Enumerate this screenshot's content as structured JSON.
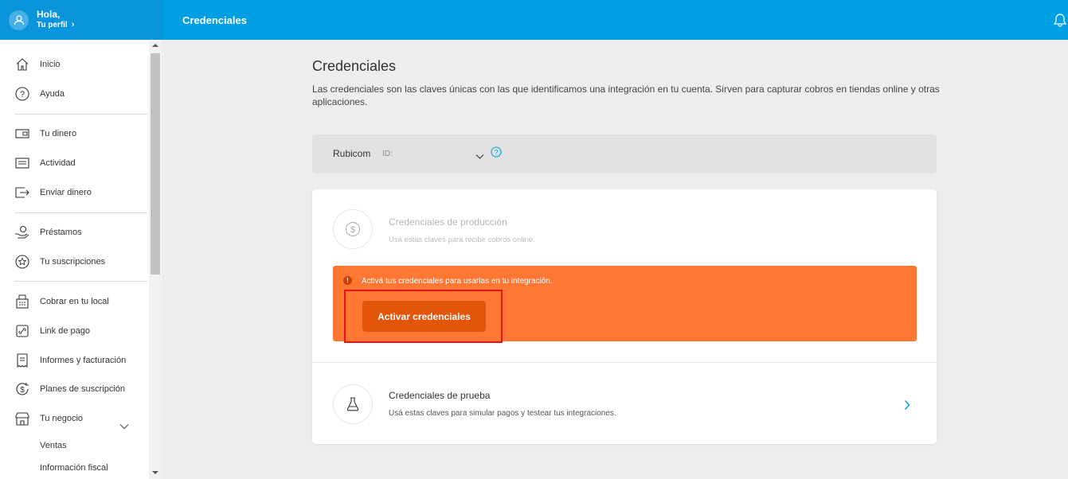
{
  "profile": {
    "greeting": "Hola,",
    "link_label": "Tu perfil"
  },
  "sidebar": {
    "items": [
      {
        "label": "Inicio",
        "icon": "home-icon"
      },
      {
        "label": "Ayuda",
        "icon": "help-icon"
      },
      {
        "label": "Tu dinero",
        "icon": "wallet-icon"
      },
      {
        "label": "Actividad",
        "icon": "list-icon"
      },
      {
        "label": "Enviar dinero",
        "icon": "send-icon"
      },
      {
        "label": "Préstamos",
        "icon": "loan-hand-icon"
      },
      {
        "label": "Tu suscripciones",
        "icon": "star-badge-icon"
      },
      {
        "label": "Cobrar en tu local",
        "icon": "register-icon"
      },
      {
        "label": "Link de pago",
        "icon": "link-icon"
      },
      {
        "label": "Informes y facturación",
        "icon": "receipt-icon"
      },
      {
        "label": "Planes de suscripción",
        "icon": "dollar-cycle-icon"
      },
      {
        "label": "Tu negocio",
        "icon": "store-icon"
      }
    ],
    "subitems": [
      "Ventas",
      "Información fiscal"
    ]
  },
  "topbar": {
    "title": "Credenciales"
  },
  "main": {
    "title": "Credenciales",
    "description": "Las credenciales son las claves únicas con las que identificamos una integración en tu cuenta. Sirven para capturar cobros en tiendas online y otras aplicaciones.",
    "account": {
      "name": "Rubicom",
      "id_label": "ID:"
    },
    "production": {
      "title": "Credenciales de producción",
      "subtitle": "Usá estas claves para recibir cobros online.",
      "warning": "Activá tus credenciales para usarlas en tu integración.",
      "button": "Activar credenciales"
    },
    "test": {
      "title": "Credenciales de prueba",
      "subtitle": "Usá estas claves para simular pagos y testear tus integraciones."
    }
  },
  "colors": {
    "topbar": "#009ee3",
    "profile": "#0994dc",
    "warning": "#ff7733",
    "button": "#e3550b",
    "highlight": "#e8141c"
  }
}
